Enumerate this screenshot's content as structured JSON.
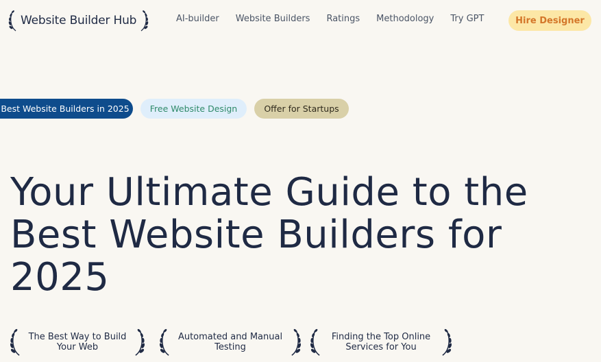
{
  "header": {
    "logo_text": "Website Builder Hub",
    "nav": [
      "AI-builder",
      "Website Builders",
      "Ratings",
      "Methodology",
      "Try GPT"
    ],
    "cta_label": "Hire Designer"
  },
  "pills": [
    {
      "label": "Best Website Builders in 2025"
    },
    {
      "label": "Free Website Design"
    },
    {
      "label": "Offer for Startups"
    }
  ],
  "hero": {
    "line1": "Your Ultimate Guide to the",
    "line2": "Best Website Builders for",
    "line3": "2025"
  },
  "badges": [
    {
      "line1": "The Best Way to Build",
      "line2": "Your Web"
    },
    {
      "line1": "Automated and Manual",
      "line2": "Testing"
    },
    {
      "line1": "Finding the Top Online",
      "line2": "Services for You"
    }
  ],
  "colors": {
    "background": "#f9f7f2",
    "text": "#1f2a44",
    "pill_primary": "#0e4c8c",
    "pill_secondary": "#dfeefb",
    "pill_tertiary": "#d9d0a8",
    "cta_bg": "#fce7a6",
    "cta_text": "#d4772a"
  },
  "icons": [
    "laurel-left-icon",
    "laurel-right-icon"
  ]
}
